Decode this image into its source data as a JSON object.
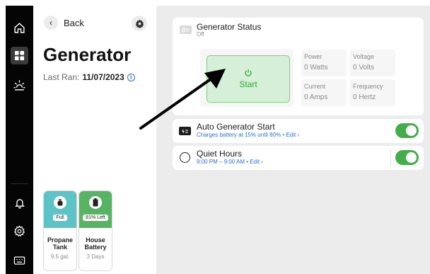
{
  "sidebar": {
    "icons": [
      "home-icon",
      "grid-icon",
      "sun-icon",
      "bell-icon",
      "gear-icon",
      "keyboard-icon"
    ],
    "active": "grid-icon"
  },
  "panel": {
    "back_label": "Back",
    "title": "Generator",
    "last_ran_label": "Last Ran:",
    "last_ran_value": "11/07/2023"
  },
  "tiles": [
    {
      "name_line1": "Propane",
      "name_line2": "Tank",
      "badge": "Full",
      "sub": "9.5 gal.",
      "color": "#5cc4c7",
      "icon": "propane-icon"
    },
    {
      "name_line1": "House",
      "name_line2": "Battery",
      "badge": "81% Left",
      "sub": "3 Days",
      "color": "#56b463",
      "icon": "battery-icon"
    }
  ],
  "generator_status": {
    "title": "Generator Status",
    "state": "Off",
    "start_label": "Start",
    "metrics": [
      {
        "label": "Power",
        "value": "0",
        "unit": "Watts"
      },
      {
        "label": "Voltage",
        "value": "0",
        "unit": "Volts"
      },
      {
        "label": "Current",
        "value": "0",
        "unit": "Amps"
      },
      {
        "label": "Frequency",
        "value": "0",
        "unit": "Hertz"
      }
    ]
  },
  "auto_start": {
    "title": "Auto Generator Start",
    "detail": "Charges battery at 15% until 80% • Edit ›",
    "enabled": true
  },
  "quiet_hours": {
    "title": "Quiet Hours",
    "detail": "9:00 PM – 9:00 AM • Edit ›",
    "enabled": true
  },
  "colors": {
    "accent_green": "#43ad4b",
    "start_green": "#2fa63a",
    "link_blue": "#2b6fd6"
  }
}
